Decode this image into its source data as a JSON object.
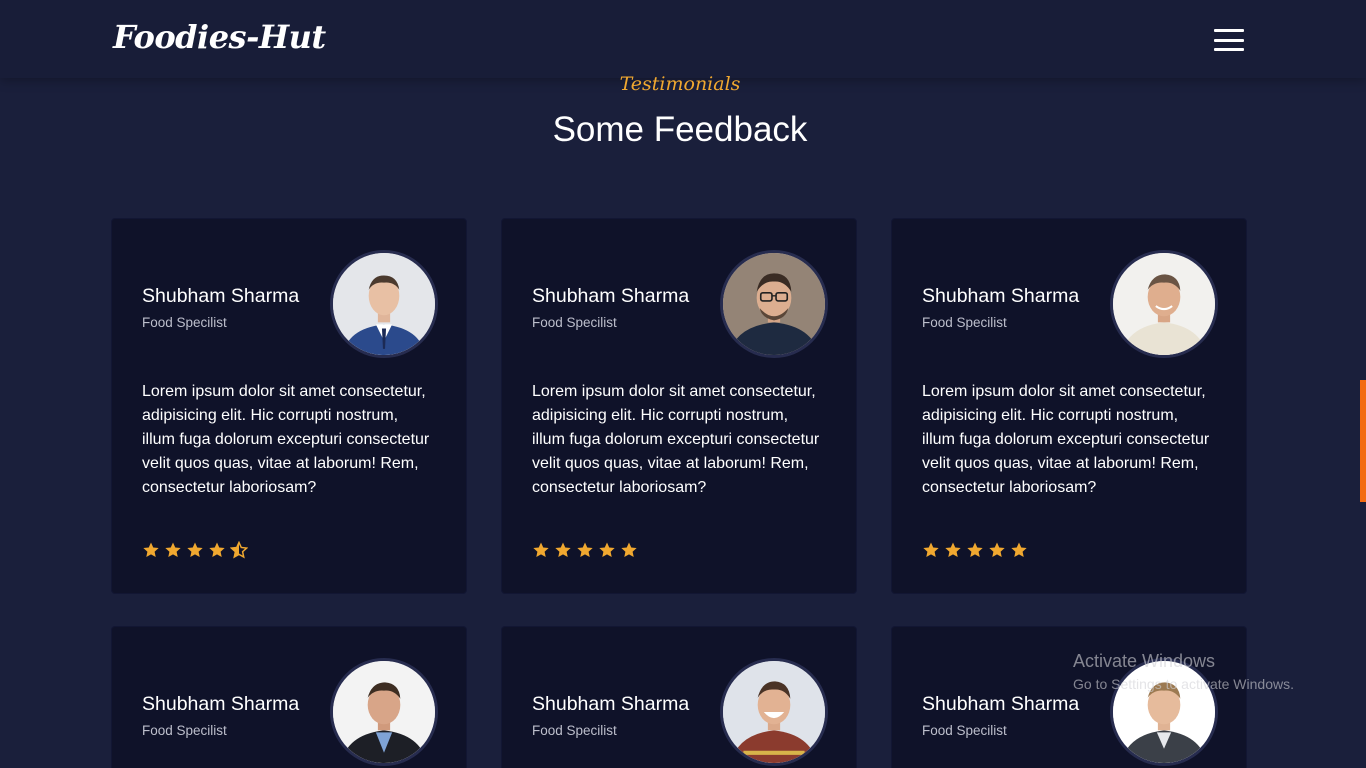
{
  "navbar": {
    "logo": "Foodies-Hut",
    "menu_icon": "hamburger-menu-icon"
  },
  "section": {
    "subtitle": "Testimonials",
    "title": "Some Feedback"
  },
  "colors": {
    "background": "#1a1f3b",
    "card": "#0f1229",
    "accent_gold": "#f0a830",
    "scroll_accent": "#f36a10"
  },
  "testimonials": [
    {
      "name": "Shubham Sharma",
      "role": "Food Specilist",
      "text": "Lorem ipsum dolor sit amet consectetur, adipisicing elit. Hic corrupti nostrum, illum fuga dolorum excepturi consectetur velit quos quas, vitae at laborum! Rem, consectetur laboriosam?",
      "rating": 4.5,
      "avatar": "man-in-blue-suit-avatar"
    },
    {
      "name": "Shubham Sharma",
      "role": "Food Specilist",
      "text": "Lorem ipsum dolor sit amet consectetur, adipisicing elit. Hic corrupti nostrum, illum fuga dolorum excepturi consectetur velit quos quas, vitae at laborum! Rem, consectetur laboriosam?",
      "rating": 5,
      "avatar": "man-with-glasses-avatar"
    },
    {
      "name": "Shubham Sharma",
      "role": "Food Specilist",
      "text": "Lorem ipsum dolor sit amet consectetur, adipisicing elit. Hic corrupti nostrum, illum fuga dolorum excepturi consectetur velit quos quas, vitae at laborum! Rem, consectetur laboriosam?",
      "rating": 5,
      "avatar": "smiling-man-avatar"
    },
    {
      "name": "Shubham Sharma",
      "role": "Food Specilist",
      "avatar": "man-in-dark-suit-avatar"
    },
    {
      "name": "Shubham Sharma",
      "role": "Food Specilist",
      "avatar": "laughing-man-avatar"
    },
    {
      "name": "Shubham Sharma",
      "role": "Food Specilist",
      "avatar": "businessman-avatar"
    }
  ],
  "os_watermark": {
    "title": "Activate Windows",
    "subtitle": "Go to Settings to activate Windows."
  }
}
